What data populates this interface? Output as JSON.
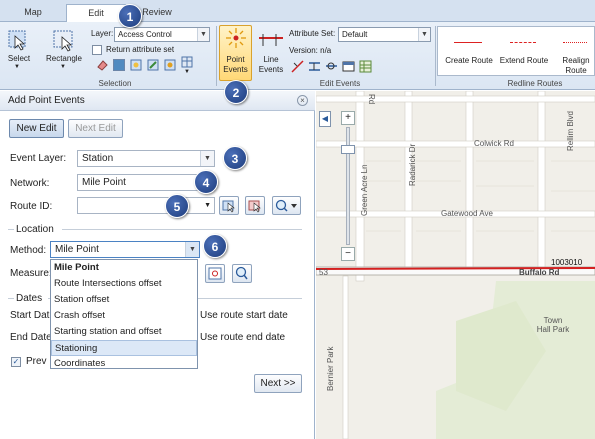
{
  "ribbon": {
    "tabs": [
      "Map",
      "Edit",
      "Review"
    ],
    "select_label": "Select",
    "rectangle_label": "Rectangle",
    "layer_label": "Layer:",
    "layer_value": "Access Control",
    "return_attr_label": "Return attribute set",
    "selection_group": "Selection",
    "point_events_label": "Point Events",
    "line_events_label": "Line Events",
    "attribute_set_label": "Attribute Set:",
    "attribute_set_value": "Default",
    "version_label": "Version: n/a",
    "edit_events_group": "Edit Events",
    "create_route_label": "Create Route",
    "extend_route_label": "Extend Route",
    "realign_route_label": "Realign Route",
    "redline_group": "Redline Routes"
  },
  "callouts": [
    "1",
    "2",
    "3",
    "4",
    "5",
    "6"
  ],
  "panel": {
    "title": "Add Point Events",
    "new_edit": "New Edit",
    "next_edit": "Next Edit",
    "event_layer_label": "Event Layer:",
    "event_layer_value": "Station",
    "network_label": "Network:",
    "network_value": "Mile Point",
    "route_id_label": "Route ID:",
    "route_id_value": "",
    "location_section": "Location",
    "method_label": "Method:",
    "method_value": "Mile Point",
    "measure_label": "Measure:",
    "method_options": [
      "Mile Point",
      "Route Intersections offset",
      "Station offset",
      "Crash offset",
      "Starting station and offset",
      "Stationing",
      "Coordinates"
    ],
    "dates_section": "Dates",
    "start_date_label": "Start Date",
    "end_date_label": "End Date",
    "use_start_label": "Use route start date",
    "use_end_label": "Use route end date",
    "preview_label": "Prev",
    "next_button": "Next >>"
  },
  "map": {
    "roads": [
      "Colwick Rd",
      "Gatewood Ave",
      "Buffalo Rd",
      "Radarick Dr",
      "Green Acre Ln",
      "Bernier Park",
      "Rellim Blvd",
      "Town Hall Park",
      "Rd",
      "53",
      "1003010"
    ]
  }
}
